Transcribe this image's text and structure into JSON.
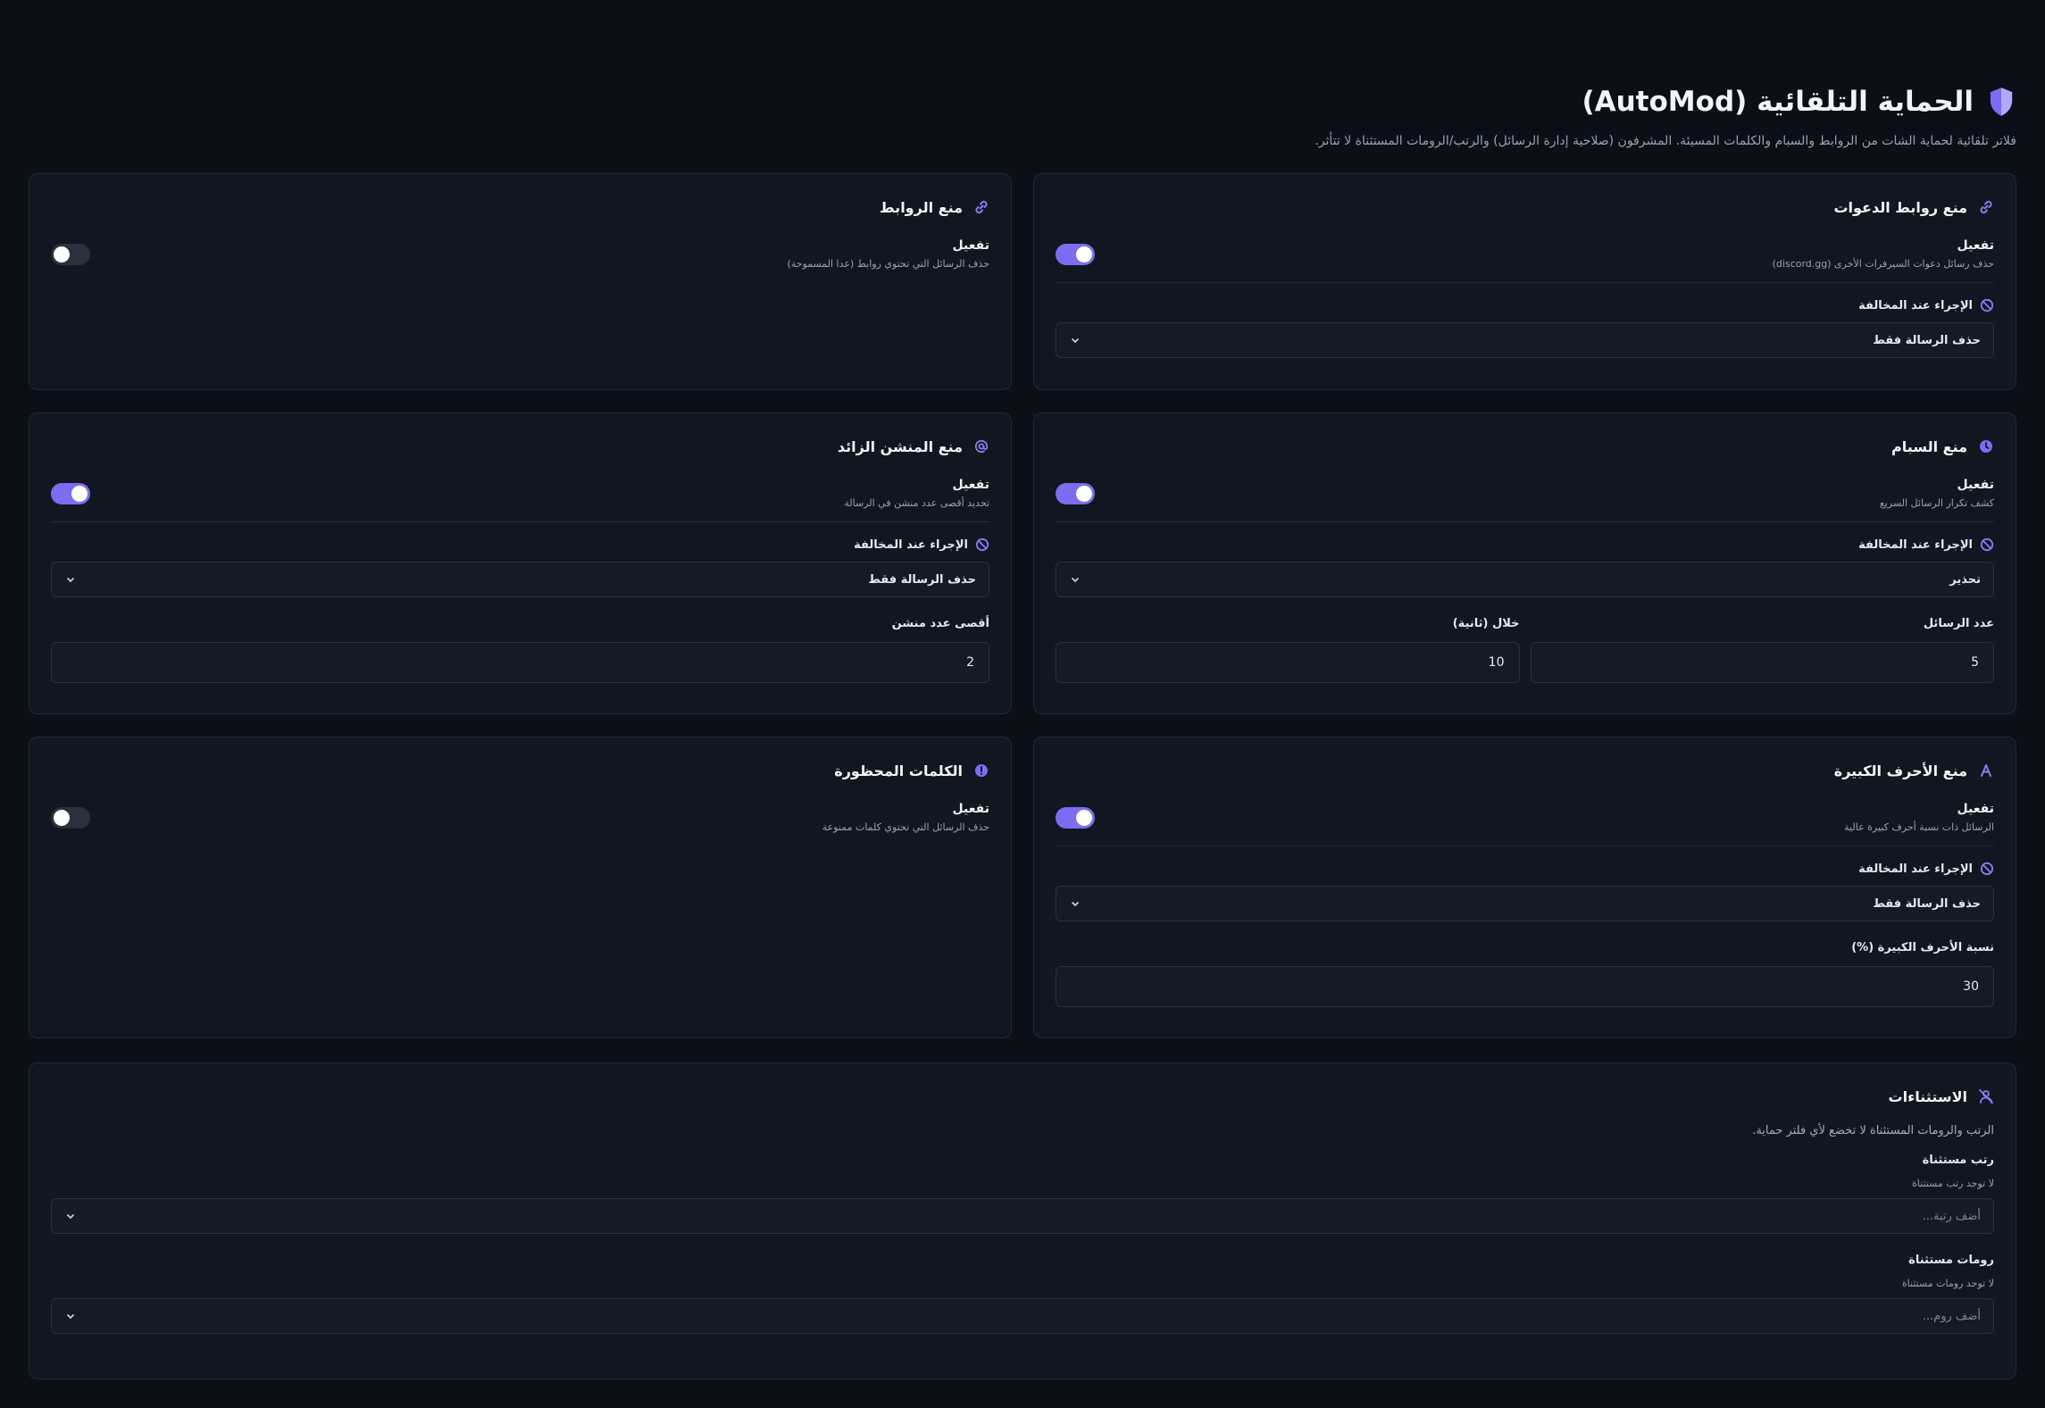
{
  "header": {
    "title": "الحماية التلقائية (AutoMod)",
    "subtitle": "فلاتر تلقائية لحماية الشات من الروابط والسبام والكلمات المسيئة. المشرفون (صلاحية إدارة الرسائل) والرتب/الرومات المستثناة لا تتأثر."
  },
  "common": {
    "enable_label": "تفعيل",
    "action_label": "الإجراء عند المخالفة"
  },
  "cards": {
    "invites": {
      "title": "منع روابط الدعوات",
      "desc": "حذف رسائل دعوات السيرفرات الأخرى (discord.gg)",
      "enabled": true,
      "action": "حذف الرسالة فقط",
      "icon": "link-icon"
    },
    "links": {
      "title": "منع الروابط",
      "desc": "حذف الرسائل التي تحتوي روابط (عدا المسموحة)",
      "enabled": false,
      "icon": "link-icon"
    },
    "spam": {
      "title": "منع السبام",
      "desc": "كشف تكرار الرسائل السريع",
      "enabled": true,
      "action": "تحذير",
      "messages_label": "عدد الرسائل",
      "messages_value": "5",
      "within_label": "خلال (ثانية)",
      "within_value": "10",
      "icon": "clock-icon"
    },
    "mentions": {
      "title": "منع المنشن الزائد",
      "desc": "تحديد أقصى عدد منشن في الرسالة",
      "enabled": true,
      "action": "حذف الرسالة فقط",
      "max_label": "أقصى عدد منشن",
      "max_value": "2",
      "icon": "at-icon"
    },
    "caps": {
      "title": "منع الأحرف الكبيرة",
      "desc": "الرسائل ذات نسبة أحرف كبيرة عالية",
      "enabled": true,
      "action": "حذف الرسالة فقط",
      "ratio_label": "نسبة الأحرف الكبيرة (%)",
      "ratio_value": "30",
      "icon": "letter-a-icon"
    },
    "badwords": {
      "title": "الكلمات المحظورة",
      "desc": "حذف الرسائل التي تحتوي كلمات ممنوعة",
      "enabled": false,
      "icon": "alert-icon"
    }
  },
  "exceptions": {
    "title": "الاستثناءات",
    "desc": "الرتب والرومات المستثناة لا تخضع لأي فلتر حماية.",
    "roles_label": "رتب مستثناة",
    "roles_empty": "لا توجد رتب مستثناة",
    "roles_placeholder": "أضف رتبة...",
    "channels_label": "رومات مستثناة",
    "channels_empty": "لا توجد رومات مستثناة",
    "channels_placeholder": "أضف روم..."
  },
  "colors": {
    "background": "#0b0f17",
    "card": "#111720",
    "accent": "#7c6cf0"
  }
}
